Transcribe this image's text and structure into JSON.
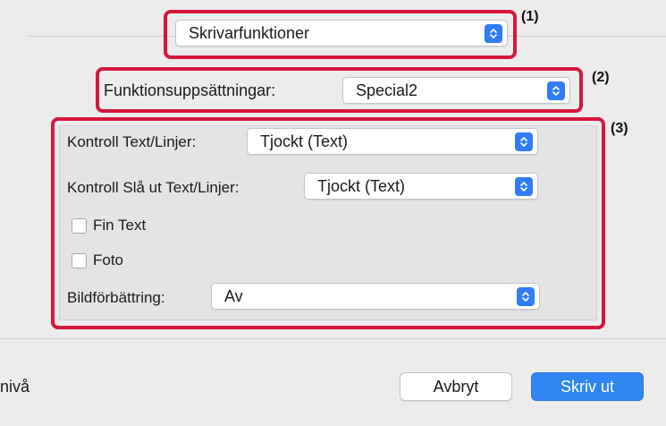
{
  "printer_features_popup": {
    "value": "Skrivarfunktioner"
  },
  "feature_sets": {
    "label": "Funktionsuppsättningar:",
    "value": "Special2"
  },
  "options": {
    "text_lines_control": {
      "label": "Kontroll Text/Linjer:",
      "value": "Tjockt (Text)"
    },
    "punch_text_lines_control": {
      "label": "Kontroll Slå ut Text/Linjer:",
      "value": "Tjockt (Text)"
    },
    "fine_text": {
      "label": "Fin Text",
      "checked": false
    },
    "photo": {
      "label": "Foto",
      "checked": false
    },
    "image_enhancement": {
      "label": "Bildförbättring:",
      "value": "Av"
    }
  },
  "callouts": {
    "c1": "(1)",
    "c2": "(2)",
    "c3": "(3)"
  },
  "footer": {
    "partial_label": "nivå",
    "cancel_button": "Avbryt",
    "print_button": "Skriv ut"
  },
  "colors": {
    "highlight": "#d4173c",
    "accent": "#2e7df6",
    "background": "#ececec"
  },
  "icons": {
    "popup_arrows": "updown-chevron-icon"
  }
}
